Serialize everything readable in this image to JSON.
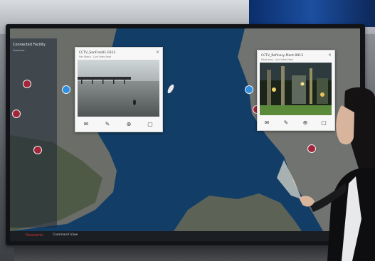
{
  "left_panel": {
    "title": "Connected Facility",
    "subtitle": "Overview"
  },
  "popup_left": {
    "title": "CCTV_SanFran01-0312",
    "subtitle": "Pier Watch - Live Video Feed",
    "close_icon": "close-icon",
    "toolbar": [
      "mail-icon",
      "edit-icon",
      "target-icon",
      "info-icon"
    ]
  },
  "popup_right": {
    "title": "CCTV_Refinery-Plant-0913",
    "subtitle": "Plant Area - Live Video Feed",
    "close_icon": "close-icon",
    "toolbar": [
      "mail-icon",
      "edit-icon",
      "target-icon",
      "info-icon"
    ]
  },
  "statusbar": {
    "brand": "Panasonic",
    "text": "Command View"
  },
  "colors": {
    "water": "#123d66",
    "land": "#6d6f6a",
    "marker_red": "#a3253a",
    "marker_blue": "#2e8fe0"
  }
}
